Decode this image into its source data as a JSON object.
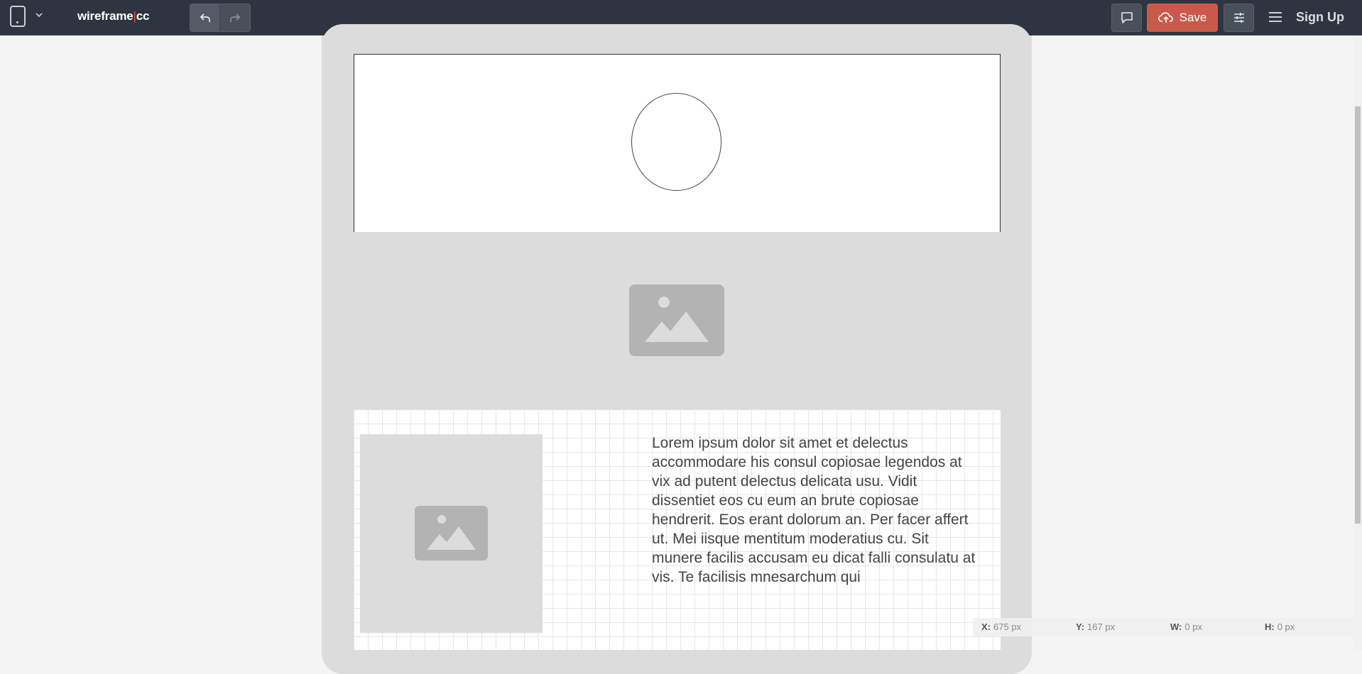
{
  "app": {
    "logo_left": "wireframe",
    "logo_sep": "|",
    "logo_right": "cc"
  },
  "toolbar": {
    "save_label": "Save",
    "signup_label": "Sign Up"
  },
  "canvas": {
    "lorem_text": "Lorem ipsum dolor sit amet et delectus accommodare his consul copiosae legendos at vix ad putent delectus delicata usu. Vidit dissentiet eos cu eum an brute copiosae hendrerit. Eos erant dolorum an. Per facer affert ut. Mei iisque mentitum moderatius cu. Sit munere facilis accusam eu dicat falli consulatu at vis. Te facilisis mnesarchum qui"
  },
  "status": {
    "x_label": "X:",
    "x_value": "675 px",
    "y_label": "Y:",
    "y_value": "167 px",
    "w_label": "W:",
    "w_value": "0 px",
    "h_label": "H:",
    "h_value": "0 px"
  },
  "colors": {
    "topbar": "#2f3540",
    "save": "#c95a4b",
    "phone": "#dcdcdc"
  }
}
